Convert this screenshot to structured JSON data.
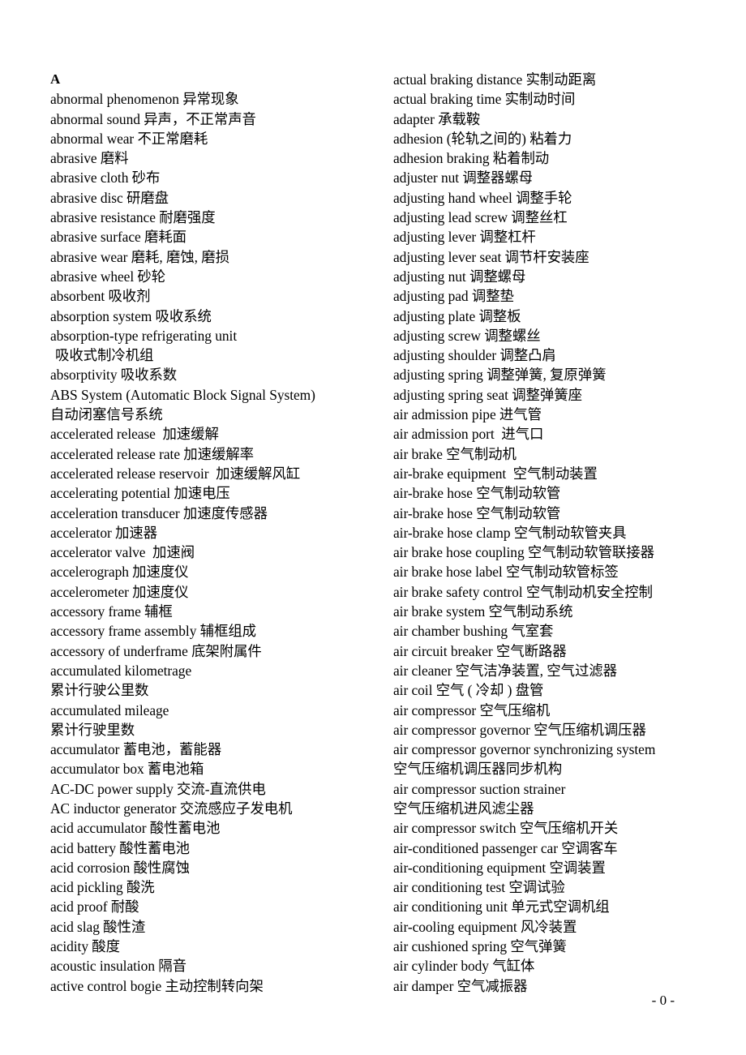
{
  "document": {
    "section_heading": "A",
    "page_number": "- 0 -"
  },
  "left_column": {
    "lines": [
      {
        "text": "abnormal phenomenon 异常现象",
        "indent": false
      },
      {
        "text": "abnormal sound 异声，不正常声音",
        "indent": false
      },
      {
        "text": "abnormal wear 不正常磨耗",
        "indent": false
      },
      {
        "text": "abrasive 磨料",
        "indent": false
      },
      {
        "text": "abrasive cloth 砂布",
        "indent": false
      },
      {
        "text": "abrasive disc 研磨盘",
        "indent": false
      },
      {
        "text": "abrasive resistance 耐磨强度",
        "indent": false
      },
      {
        "text": "abrasive surface 磨耗面",
        "indent": false
      },
      {
        "text": "abrasive wear 磨耗, 磨蚀, 磨损",
        "indent": false
      },
      {
        "text": "abrasive wheel 砂轮",
        "indent": false
      },
      {
        "text": "absorbent 吸收剂",
        "indent": false
      },
      {
        "text": "absorption system 吸收系统",
        "indent": false
      },
      {
        "text": "absorption-type refrigerating unit",
        "indent": false
      },
      {
        "text": "吸收式制冷机组",
        "indent": true
      },
      {
        "text": "absorptivity 吸收系数",
        "indent": false
      },
      {
        "text": "ABS System (Automatic Block Signal System)",
        "indent": false
      },
      {
        "text": "自动闭塞信号系统",
        "indent": false
      },
      {
        "text": "accelerated release  加速缓解",
        "indent": false
      },
      {
        "text": "accelerated release rate 加速缓解率",
        "indent": false
      },
      {
        "text": "accelerated release reservoir  加速缓解风缸",
        "indent": false
      },
      {
        "text": "accelerating potential 加速电压",
        "indent": false
      },
      {
        "text": "acceleration transducer 加速度传感器",
        "indent": false
      },
      {
        "text": "accelerator 加速器",
        "indent": false
      },
      {
        "text": "accelerator valve  加速阀",
        "indent": false
      },
      {
        "text": "accelerograph 加速度仪",
        "indent": false
      },
      {
        "text": "accelerometer 加速度仪",
        "indent": false
      },
      {
        "text": "accessory frame 辅框",
        "indent": false
      },
      {
        "text": "accessory frame assembly 辅框组成",
        "indent": false
      },
      {
        "text": "accessory of underframe 底架附属件",
        "indent": false
      },
      {
        "text": "accumulated kilometrage",
        "indent": false
      },
      {
        "text": "累计行驶公里数",
        "indent": false
      },
      {
        "text": "accumulated mileage",
        "indent": false
      },
      {
        "text": "累计行驶里数",
        "indent": false
      },
      {
        "text": "accumulator 蓄电池，蓄能器",
        "indent": false
      },
      {
        "text": "accumulator box 蓄电池箱",
        "indent": false
      },
      {
        "text": "AC-DC power supply 交流-直流供电",
        "indent": false
      },
      {
        "text": "AC inductor generator 交流感应子发电机",
        "indent": false
      },
      {
        "text": "acid accumulator 酸性蓄电池",
        "indent": false
      },
      {
        "text": "acid battery 酸性蓄电池",
        "indent": false
      },
      {
        "text": "acid corrosion 酸性腐蚀",
        "indent": false
      },
      {
        "text": "acid pickling 酸洗",
        "indent": false
      },
      {
        "text": "acid proof 耐酸",
        "indent": false
      },
      {
        "text": "acid slag 酸性渣",
        "indent": false
      },
      {
        "text": "acidity 酸度",
        "indent": false
      },
      {
        "text": "acoustic insulation 隔音",
        "indent": false
      },
      {
        "text": "active control bogie 主动控制转向架",
        "indent": false
      }
    ]
  },
  "right_column": {
    "lines": [
      {
        "text": "actual braking distance 实制动距离",
        "indent": false
      },
      {
        "text": "actual braking time 实制动时间",
        "indent": false
      },
      {
        "text": "adapter 承载鞍",
        "indent": false
      },
      {
        "text": "adhesion (轮轨之间的) 粘着力",
        "indent": false
      },
      {
        "text": "adhesion braking 粘着制动",
        "indent": false
      },
      {
        "text": "adjuster nut 调整器螺母",
        "indent": false
      },
      {
        "text": "adjusting hand wheel 调整手轮",
        "indent": false
      },
      {
        "text": "adjusting lead screw 调整丝杠",
        "indent": false
      },
      {
        "text": "adjusting lever 调整杠杆",
        "indent": false
      },
      {
        "text": "adjusting lever seat 调节杆安装座",
        "indent": false
      },
      {
        "text": "adjusting nut 调整螺母",
        "indent": false
      },
      {
        "text": "adjusting pad 调整垫",
        "indent": false
      },
      {
        "text": "adjusting plate 调整板",
        "indent": false
      },
      {
        "text": "adjusting screw 调整螺丝",
        "indent": false
      },
      {
        "text": "adjusting shoulder 调整凸肩",
        "indent": false
      },
      {
        "text": "adjusting spring 调整弹簧, 复原弹簧",
        "indent": false
      },
      {
        "text": "adjusting spring seat 调整弹簧座",
        "indent": false
      },
      {
        "text": "air admission pipe 进气管",
        "indent": false
      },
      {
        "text": "air admission port  进气口",
        "indent": false
      },
      {
        "text": "air brake 空气制动机",
        "indent": false
      },
      {
        "text": "air-brake equipment  空气制动装置",
        "indent": false
      },
      {
        "text": "air-brake hose 空气制动软管",
        "indent": false
      },
      {
        "text": "air-brake hose 空气制动软管",
        "indent": false
      },
      {
        "text": "air-brake hose clamp 空气制动软管夹具",
        "indent": false
      },
      {
        "text": "air brake hose coupling 空气制动软管联接器",
        "indent": false
      },
      {
        "text": "air brake hose label 空气制动软管标签",
        "indent": false
      },
      {
        "text": "air brake safety control 空气制动机安全控制",
        "indent": false
      },
      {
        "text": "air brake system 空气制动系统",
        "indent": false
      },
      {
        "text": "air chamber bushing 气室套",
        "indent": false
      },
      {
        "text": "air circuit breaker 空气断路器",
        "indent": false
      },
      {
        "text": "air cleaner 空气洁净装置, 空气过滤器",
        "indent": false
      },
      {
        "text": "air coil 空气 ( 冷却 ) 盘管",
        "indent": false
      },
      {
        "text": "air compressor 空气压缩机",
        "indent": false
      },
      {
        "text": "air compressor governor 空气压缩机调压器",
        "indent": false
      },
      {
        "text": "air compressor governor synchronizing system",
        "indent": false
      },
      {
        "text": "空气压缩机调压器同步机构",
        "indent": false
      },
      {
        "text": "air compressor suction strainer",
        "indent": false
      },
      {
        "text": "空气压缩机进风滤尘器",
        "indent": false
      },
      {
        "text": "air compressor switch 空气压缩机开关",
        "indent": false
      },
      {
        "text": "air-conditioned passenger car 空调客车",
        "indent": false
      },
      {
        "text": "air-conditioning equipment 空调装置",
        "indent": false
      },
      {
        "text": "air conditioning test 空调试验",
        "indent": false
      },
      {
        "text": "air conditioning unit 单元式空调机组",
        "indent": false
      },
      {
        "text": "air-cooling equipment 风冷装置",
        "indent": false
      },
      {
        "text": "air cushioned spring 空气弹簧",
        "indent": false
      },
      {
        "text": "air cylinder body 气缸体",
        "indent": false
      },
      {
        "text": "air damper 空气减振器",
        "indent": false
      }
    ]
  }
}
